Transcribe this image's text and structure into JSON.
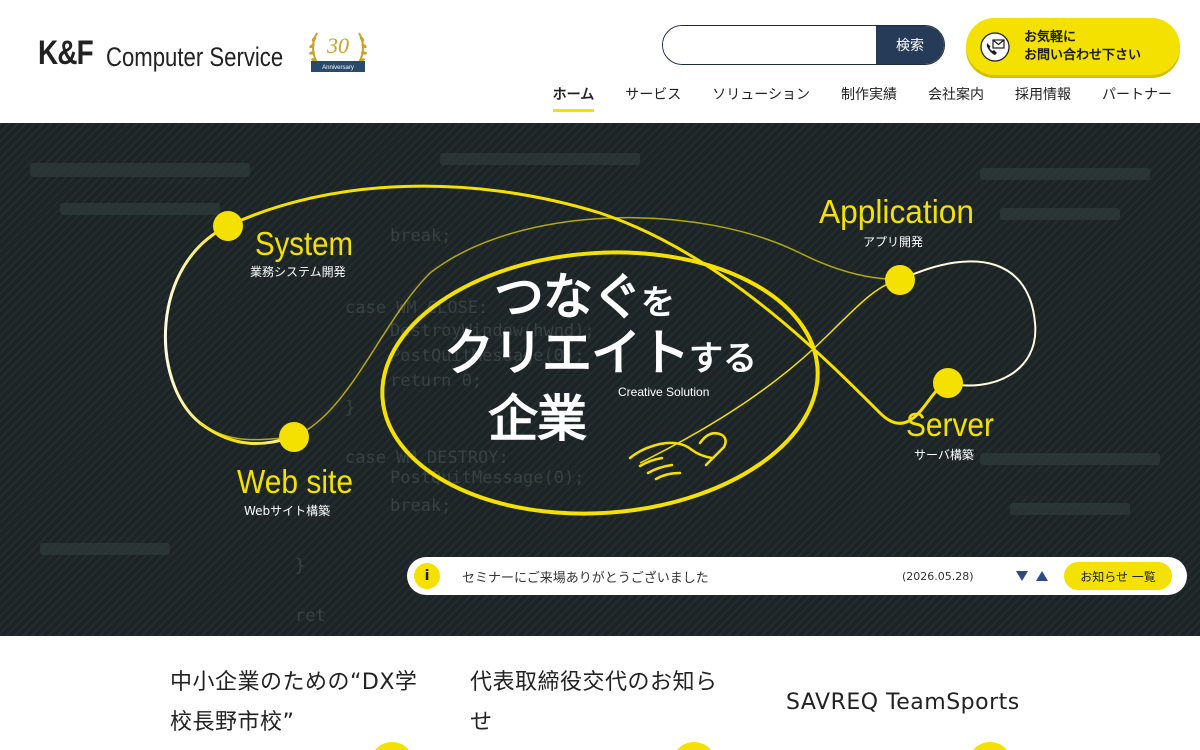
{
  "header": {
    "logo_main": "K&F",
    "logo_sub": "Computer Service",
    "badge_number": "30",
    "badge_text": "Anniversary",
    "search_placeholder": "",
    "search_button": "検索",
    "contact_line1": "お気軽に",
    "contact_line2": "お問い合わせ下さい"
  },
  "nav": {
    "items": [
      "ホーム",
      "サービス",
      "ソリューション",
      "制作実績",
      "会社案内",
      "採用情報",
      "パートナー"
    ]
  },
  "hero": {
    "headline_1a": "つなぐ",
    "headline_1b": "を",
    "headline_2a": "クリエイト",
    "headline_2b": "する",
    "headline_3": "企業",
    "tagline": "Creative Solution",
    "system_en": "System",
    "system_jp": "業務システム開発",
    "web_en": "Web site",
    "web_jp": "Webサイト構築",
    "app_en": "Application",
    "app_jp": "アプリ開発",
    "server_en": "Server",
    "server_jp": "サーバ構築",
    "code": [
      "break;",
      "case WM_CLOSE:",
      "DestroyWindow(hwnd);",
      "PostQuitMessage(0);",
      "return 0;",
      "}",
      "case WM_DESTROY:",
      "PostQuitMessage(0);",
      "break;",
      "}",
      "ret"
    ]
  },
  "news": {
    "icon": "i",
    "text": "セミナーにご来場ありがとうございました",
    "date": "(2026.05.28)",
    "all_label": "お知らせ 一覧"
  },
  "cards": [
    {
      "line1": "中小企業のための“DX学",
      "line2": "校長野市校”"
    },
    {
      "line1": "代表取締役交代のお知ら",
      "line2": "せ"
    },
    {
      "line1": "SAVREQ TeamSports",
      "line2": ""
    }
  ],
  "colors": {
    "accent": "#f4e100",
    "navy": "#263b57",
    "hero_bg": "#1d2426"
  }
}
